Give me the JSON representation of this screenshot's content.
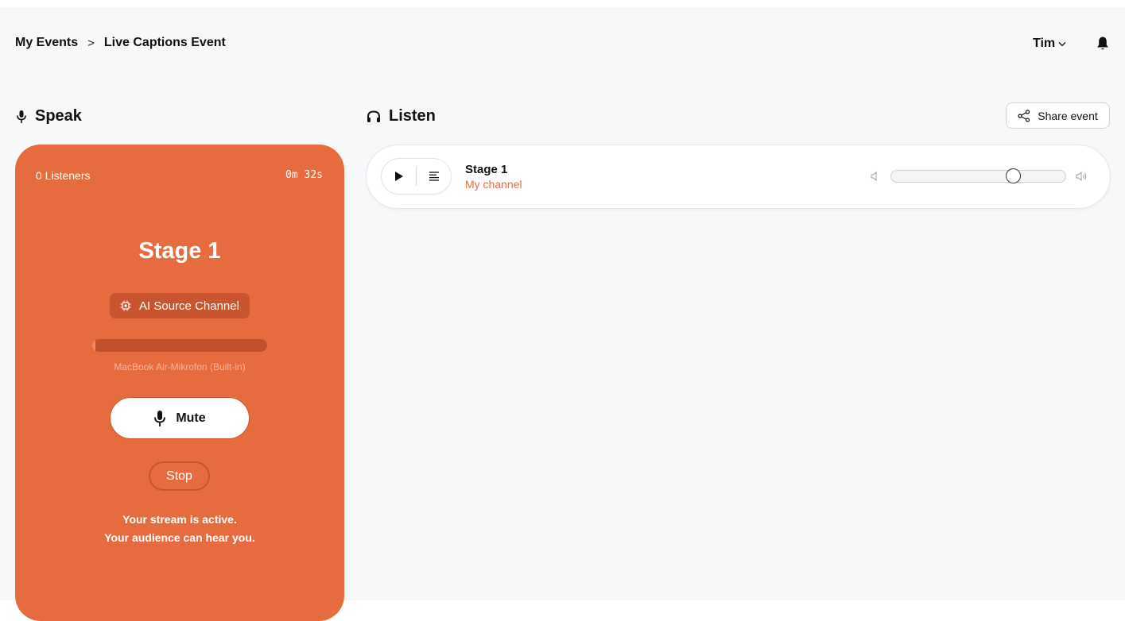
{
  "breadcrumb": {
    "root": "My Events",
    "separator": ">",
    "current": "Live Captions Event"
  },
  "user": {
    "name": "Tim",
    "chevron": "chevron-down-icon"
  },
  "speak": {
    "title": "Speak",
    "icon": "microphone-icon",
    "listeners": "0 Listeners",
    "elapsed": "0m 32s",
    "stage_name": "Stage 1",
    "ai_badge_label": "AI Source Channel",
    "input_level": 0.02,
    "device_name": "MacBook Air-Mikrofon (Built-in)",
    "mute_label": "Mute",
    "stop_label": "Stop",
    "status_line1": "Your stream is active.",
    "status_line2": "Your audience can hear you."
  },
  "listen": {
    "title": "Listen",
    "icon": "headphones-icon",
    "share_label": "Share event",
    "channel": {
      "name": "Stage 1",
      "subtitle": "My channel",
      "volume": 0.72
    }
  },
  "colors": {
    "accent": "#e66c40",
    "accent_dark": "#c85530",
    "background": "#f7f8fa"
  }
}
